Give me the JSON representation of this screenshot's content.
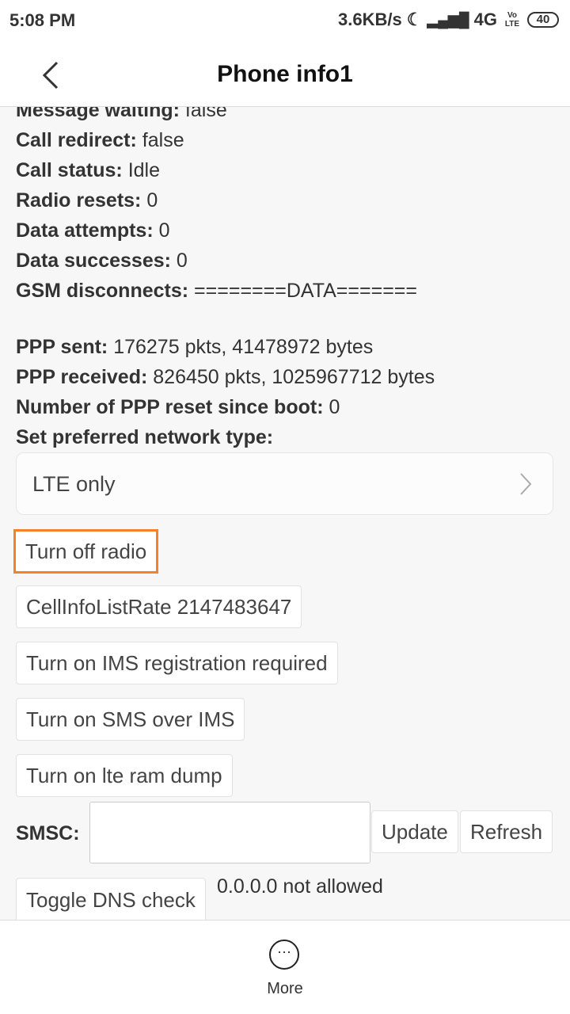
{
  "status_bar": {
    "time": "5:08 PM",
    "speed": "3.6KB/s",
    "network": "4G",
    "volte": "Vo LTE",
    "battery": "40"
  },
  "header": {
    "title": "Phone info1"
  },
  "info": [
    {
      "label": "Message waiting:",
      "value": " false"
    },
    {
      "label": "Call redirect:",
      "value": " false"
    },
    {
      "label": "Call status:",
      "value": " Idle"
    },
    {
      "label": "Radio resets:",
      "value": " 0"
    },
    {
      "label": "Data attempts:",
      "value": " 0"
    },
    {
      "label": "Data successes:",
      "value": " 0"
    },
    {
      "label": "GSM disconnects:",
      "value": " ========DATA======="
    },
    {
      "label": "PPP sent:",
      "value": " 176275 pkts, 41478972 bytes"
    },
    {
      "label": "PPP received:",
      "value": " 826450 pkts, 1025967712 bytes"
    },
    {
      "label": "Number of PPP reset since boot:",
      "value": " 0"
    },
    {
      "label": "Set preferred network type:",
      "value": ""
    }
  ],
  "network_type": {
    "selected": "LTE only"
  },
  "buttons": {
    "turn_off_radio": "Turn off radio",
    "cell_info_rate": "CellInfoListRate 2147483647",
    "ims_registration": "Turn on IMS registration required",
    "sms_over_ims": "Turn on SMS over IMS",
    "lte_ram_dump": "Turn on lte ram dump",
    "update": "Update",
    "refresh": "Refresh",
    "toggle_dns": "Toggle DNS check"
  },
  "smsc": {
    "label": "SMSC:",
    "value": ""
  },
  "dns_status": "0.0.0.0 not allowed",
  "bottom": {
    "more_label": "More"
  }
}
